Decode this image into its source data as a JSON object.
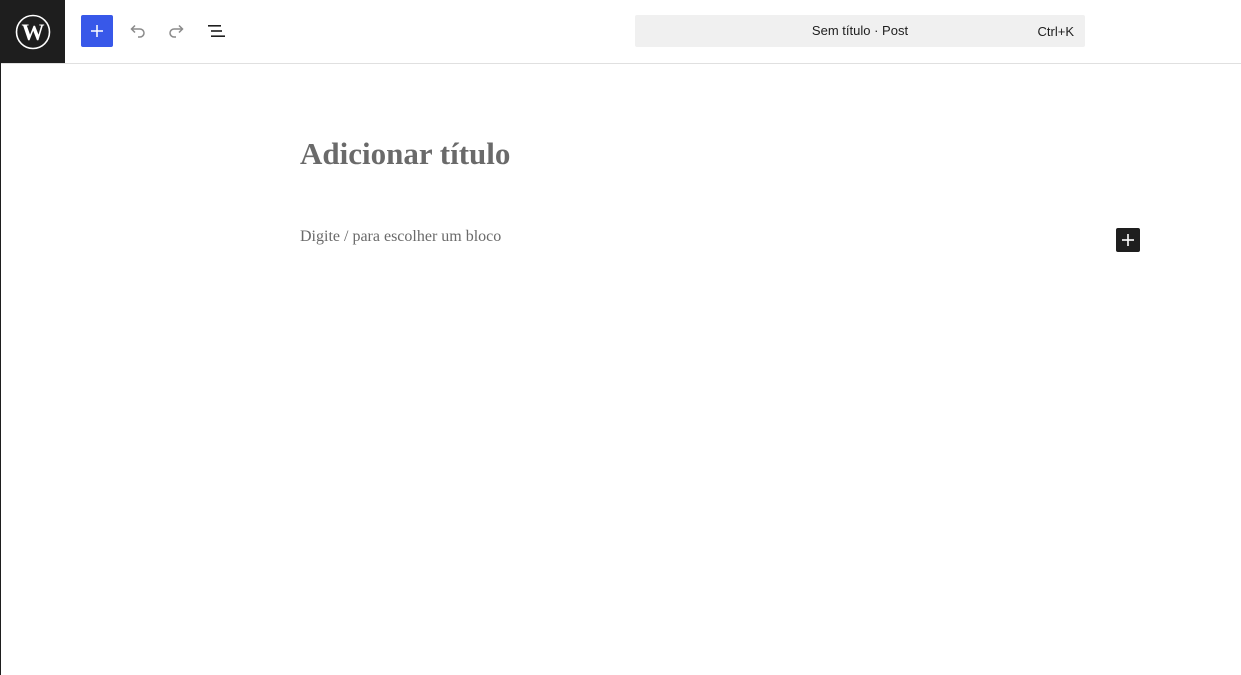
{
  "header": {
    "logo_icon": "wordpress-logo-icon",
    "inserter_icon": "plus-icon",
    "undo_icon": "undo-icon",
    "redo_icon": "redo-icon",
    "list_view_icon": "list-view-icon",
    "command_bar": {
      "title": "Sem título",
      "separator": "·",
      "post_type": "Post",
      "shortcut": "Ctrl+K"
    }
  },
  "editor": {
    "title_placeholder": "Adicionar título",
    "block_placeholder": "Digite / para escolher um bloco",
    "block_inserter_icon": "plus-icon"
  },
  "colors": {
    "accent": "#3858e9",
    "dark": "#1e1e1e",
    "placeholder_text": "#6a6a6a",
    "command_bg": "#f0f0f0"
  }
}
